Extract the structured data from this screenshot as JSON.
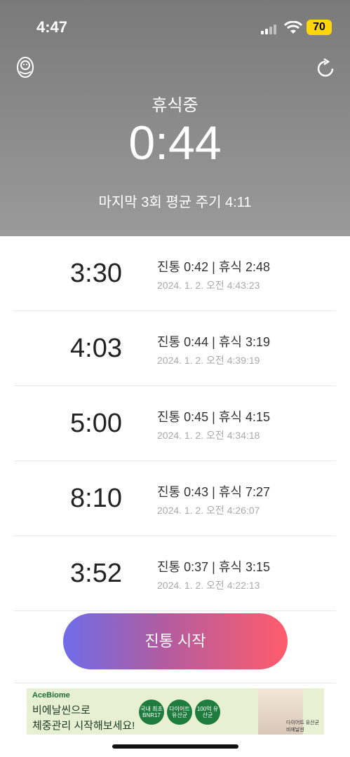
{
  "status_bar": {
    "time": "4:47",
    "battery": "70"
  },
  "header": {
    "state": "휴식중",
    "timer": "0:44",
    "average": "마지막 3회 평균 주기 4:11"
  },
  "records": [
    {
      "interval": "3:30",
      "detail": "진통 0:42 | 휴식 2:48",
      "date": "2024. 1. 2. 오전 4:43:23"
    },
    {
      "interval": "4:03",
      "detail": "진통 0:44 | 휴식 3:19",
      "date": "2024. 1. 2. 오전 4:39:19"
    },
    {
      "interval": "5:00",
      "detail": "진통 0:45 | 휴식 4:15",
      "date": "2024. 1. 2. 오전 4:34:18"
    },
    {
      "interval": "8:10",
      "detail": "진통 0:43 | 휴식 7:27",
      "date": "2024. 1. 2. 오전 4:26:07"
    },
    {
      "interval": "3:52",
      "detail": "진통 0:37 | 휴식 3:15",
      "date": "2024. 1. 2. 오전 4:22:13"
    }
  ],
  "start_button": {
    "label": "진통 시작"
  },
  "ad": {
    "brand": "AceBiome",
    "line1": "비에날씬으로",
    "line2": "체중관리 시작해보세요!",
    "badges": [
      "국내 최초 BNR17",
      "다이어트 유산균",
      "100억 유산균"
    ],
    "note": "다이어트 유산균 비에날씬"
  },
  "colors": {
    "header_bg": "#8a8a8a",
    "accent_start": "#6f6ce8",
    "accent_end": "#ff5c6b"
  }
}
